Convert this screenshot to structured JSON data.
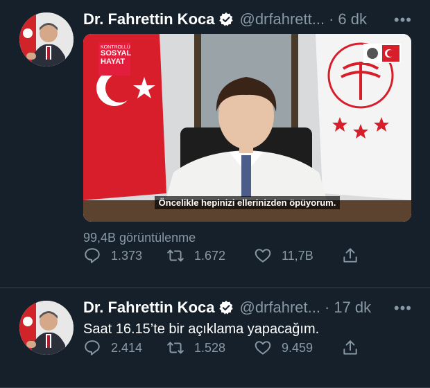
{
  "tweets": [
    {
      "author_name": "Dr. Fahrettin Koca",
      "handle": "@drfahrett...",
      "separator": "·",
      "time": "6 dk",
      "more_label": "•••",
      "video": {
        "badge_small": "KONTROLLÜ",
        "badge_big_1": "SOSYAL",
        "badge_big_2": "HAYAT",
        "caption": "Öncelikle hepinizi ellerinizden öpüyorum."
      },
      "views": "99,4B görüntülenme",
      "replies": "1.373",
      "retweets": "1.672",
      "likes": "11,7B"
    },
    {
      "author_name": "Dr. Fahrettin Koca",
      "handle": "@drfahret...",
      "separator": "·",
      "time": "17 dk",
      "more_label": "•••",
      "text": "Saat 16.15’te bir açıklama yapacağım.",
      "replies": "2.414",
      "retweets": "1.528",
      "likes": "9.459"
    }
  ],
  "colors": {
    "background": "#15202b",
    "secondary_text": "#8899a6",
    "verified": "#ffffff",
    "divider": "#38444d"
  },
  "icons": [
    "verified-badge-icon",
    "reply-icon",
    "retweet-icon",
    "like-icon",
    "share-icon",
    "more-icon"
  ]
}
